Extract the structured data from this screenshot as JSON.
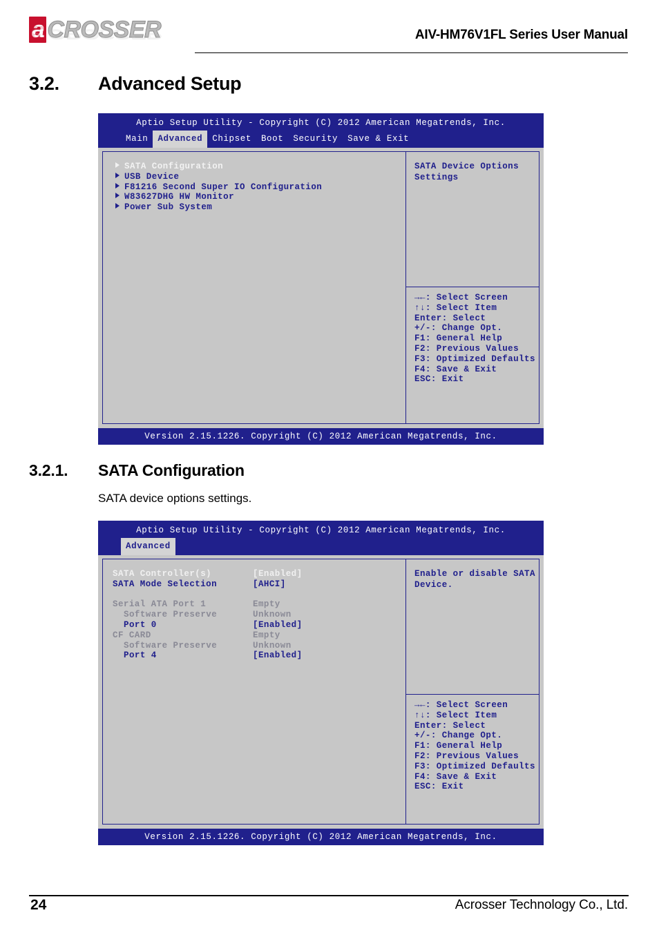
{
  "header": {
    "logo_accent_letter": "a",
    "logo_text": "CROSSER",
    "manual_title": "AIV-HM76V1FL Series User Manual",
    "brand_red": "#c8102e",
    "logo_gray": "#b9b9b9"
  },
  "sections": {
    "s32": {
      "number": "3.2.",
      "title": "Advanced Setup"
    },
    "s321": {
      "number": "3.2.1.",
      "title": "SATA Configuration",
      "body": "SATA device options settings."
    }
  },
  "bios_colors": {
    "screen_blue": "#20208c",
    "panel_gray": "#c7c7c7",
    "selected_text": "#f2f2f2",
    "disabled_text": "#8a8a96"
  },
  "nav_keys": [
    "→←: Select Screen",
    "↑↓: Select Item",
    "Enter: Select",
    "+/-: Change Opt.",
    "F1: General Help",
    "F2: Previous Values",
    "F3: Optimized Defaults",
    "F4: Save & Exit",
    "ESC: Exit"
  ],
  "screen_advanced": {
    "title": "Aptio Setup Utility - Copyright (C) 2012 American Megatrends, Inc.",
    "tabs": [
      {
        "label": "Main",
        "active": false
      },
      {
        "label": "Advanced",
        "active": true
      },
      {
        "label": "Chipset",
        "active": false
      },
      {
        "label": "Boot",
        "active": false
      },
      {
        "label": "Security",
        "active": false
      },
      {
        "label": "Save & Exit",
        "active": false
      }
    ],
    "menu_items": [
      {
        "label": "SATA Configuration",
        "selected": true
      },
      {
        "label": "USB Device",
        "selected": false
      },
      {
        "label": "F81216 Second Super IO Configuration",
        "selected": false
      },
      {
        "label": "W83627DHG HW Monitor",
        "selected": false
      },
      {
        "label": "Power Sub System",
        "selected": false
      }
    ],
    "help_lines": [
      "SATA Device Options",
      "Settings"
    ],
    "footer": "Version 2.15.1226. Copyright (C) 2012 American Megatrends, Inc."
  },
  "screen_sata": {
    "title": "Aptio Setup Utility - Copyright (C) 2012 American Megatrends, Inc.",
    "tabs": [
      {
        "label": "Advanced",
        "active": true
      }
    ],
    "rows": [
      {
        "key": "SATA Controller(s)",
        "value": "[Enabled]",
        "style": "sel",
        "indent": false
      },
      {
        "key": "SATA Mode Selection",
        "value": "[AHCI]",
        "style": "normal",
        "indent": false
      },
      {
        "key": "",
        "value": "",
        "style": "blank",
        "indent": false
      },
      {
        "key": "Serial ATA Port 1",
        "value": "Empty",
        "style": "gray",
        "indent": false
      },
      {
        "key": "Software Preserve",
        "value": "Unknown",
        "style": "gray",
        "indent": true
      },
      {
        "key": "Port 0",
        "value": "[Enabled]",
        "style": "normal",
        "indent": true
      },
      {
        "key": "CF CARD",
        "value": "Empty",
        "style": "gray",
        "indent": false
      },
      {
        "key": "Software Preserve",
        "value": "Unknown",
        "style": "gray",
        "indent": true
      },
      {
        "key": "Port 4",
        "value": "[Enabled]",
        "style": "normal",
        "indent": true
      }
    ],
    "help_lines": [
      "Enable or disable SATA",
      "Device."
    ],
    "footer": "Version 2.15.1226. Copyright (C) 2012 American Megatrends, Inc."
  },
  "page_footer": {
    "page_number": "24",
    "company": "Acrosser Technology Co., Ltd."
  }
}
